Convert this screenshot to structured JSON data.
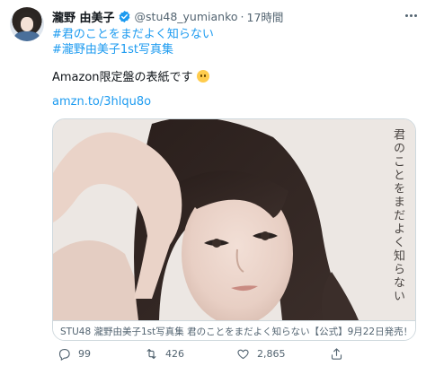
{
  "author": {
    "display_name": "瀧野 由美子",
    "handle": "@stu48_yumianko",
    "separator": "·",
    "time": "17時間",
    "verified": true
  },
  "tweet": {
    "hashtags": [
      "#君のことをまだよく知らない",
      "#瀧野由美子1st写真集"
    ],
    "text": "Amazon限定盤の表紙です",
    "emoji": "grimacing-face-emoji",
    "link": "amzn.to/3hlqu8o"
  },
  "card": {
    "cover_title": "君のことをまだよく知らない",
    "caption": "STU48 瀧野由美子1st写真集 君のことをまだよく知らない【公式】9月22日発売！"
  },
  "actions": {
    "reply_count": "99",
    "retweet_count": "426",
    "like_count": "2,865"
  },
  "colors": {
    "accent": "#1d9bf0",
    "secondary_text": "#536471",
    "border": "#cfd9de"
  }
}
